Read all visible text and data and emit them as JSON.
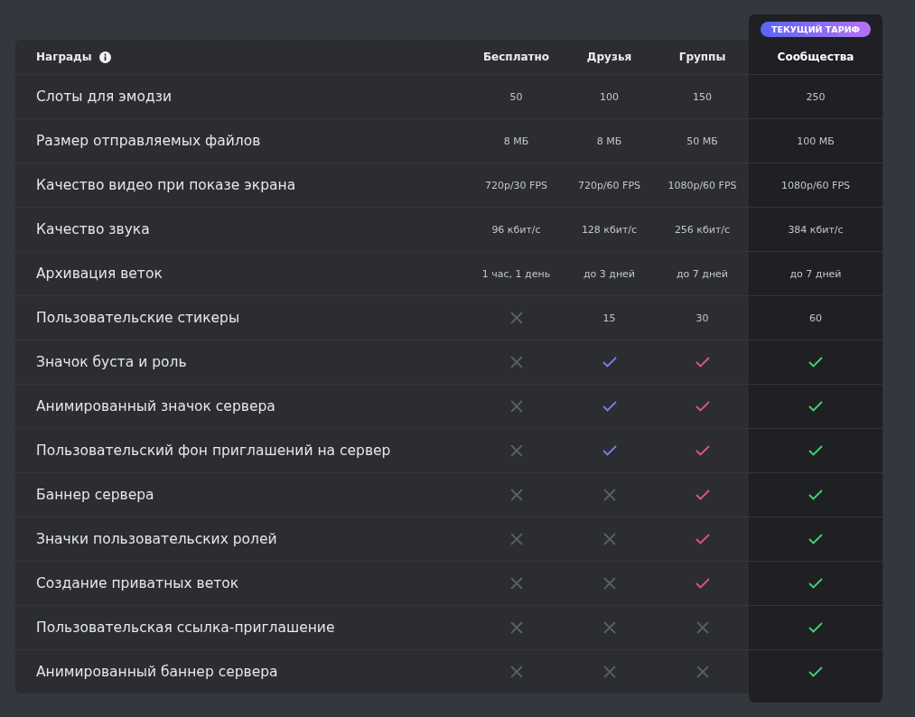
{
  "header": {
    "label": "Награды"
  },
  "current_badge": "ТЕКУЩИЙ ТАРИФ",
  "columns": [
    {
      "label": "Бесплатно",
      "selected": false
    },
    {
      "label": "Друзья",
      "color": "#7b7fe8",
      "selected": false
    },
    {
      "label": "Группы",
      "color": "#e0538f",
      "selected": false
    },
    {
      "label": "Сообщества",
      "color": "#43d17a",
      "selected": true
    }
  ],
  "rows": [
    {
      "label": "Слоты для эмодзи",
      "cells": [
        {
          "kind": "text",
          "text": "50"
        },
        {
          "kind": "text",
          "text": "100"
        },
        {
          "kind": "text",
          "text": "150"
        },
        {
          "kind": "text",
          "text": "250"
        }
      ]
    },
    {
      "label": "Размер отправляемых файлов",
      "cells": [
        {
          "kind": "text",
          "text": "8 МБ"
        },
        {
          "kind": "text",
          "text": "8 МБ"
        },
        {
          "kind": "text",
          "text": "50 МБ"
        },
        {
          "kind": "text",
          "text": "100 МБ"
        }
      ]
    },
    {
      "label": "Качество видео при показе экрана",
      "cells": [
        {
          "kind": "text",
          "text": "720p/30 FPS"
        },
        {
          "kind": "text",
          "text": "720p/60 FPS"
        },
        {
          "kind": "text",
          "text": "1080p/60 FPS"
        },
        {
          "kind": "text",
          "text": "1080p/60 FPS"
        }
      ]
    },
    {
      "label": "Качество звука",
      "cells": [
        {
          "kind": "text",
          "text": "96 кбит/с"
        },
        {
          "kind": "text",
          "text": "128 кбит/с"
        },
        {
          "kind": "text",
          "text": "256 кбит/с"
        },
        {
          "kind": "text",
          "text": "384 кбит/с"
        }
      ]
    },
    {
      "label": "Архивация веток",
      "cells": [
        {
          "kind": "text",
          "text": "1 час, 1 день"
        },
        {
          "kind": "text",
          "text": "до 3 дней"
        },
        {
          "kind": "text",
          "text": "до 7 дней"
        },
        {
          "kind": "text",
          "text": "до 7 дней"
        }
      ]
    },
    {
      "label": "Пользовательские стикеры",
      "cells": [
        {
          "kind": "cross"
        },
        {
          "kind": "text",
          "text": "15"
        },
        {
          "kind": "text",
          "text": "30"
        },
        {
          "kind": "text",
          "text": "60"
        }
      ]
    },
    {
      "label": "Значок буста и роль",
      "cells": [
        {
          "kind": "cross"
        },
        {
          "kind": "check"
        },
        {
          "kind": "check"
        },
        {
          "kind": "check"
        }
      ]
    },
    {
      "label": "Анимированный значок сервера",
      "cells": [
        {
          "kind": "cross"
        },
        {
          "kind": "check"
        },
        {
          "kind": "check"
        },
        {
          "kind": "check"
        }
      ]
    },
    {
      "label": "Пользовательский фон приглашений на сервер",
      "cells": [
        {
          "kind": "cross"
        },
        {
          "kind": "check"
        },
        {
          "kind": "check"
        },
        {
          "kind": "check"
        }
      ]
    },
    {
      "label": "Баннер сервера",
      "cells": [
        {
          "kind": "cross"
        },
        {
          "kind": "cross"
        },
        {
          "kind": "check"
        },
        {
          "kind": "check"
        }
      ]
    },
    {
      "label": "Значки пользовательских ролей",
      "cells": [
        {
          "kind": "cross"
        },
        {
          "kind": "cross"
        },
        {
          "kind": "check"
        },
        {
          "kind": "check"
        }
      ]
    },
    {
      "label": "Создание приватных веток",
      "cells": [
        {
          "kind": "cross"
        },
        {
          "kind": "cross"
        },
        {
          "kind": "check"
        },
        {
          "kind": "check"
        }
      ]
    },
    {
      "label": "Пользовательская ссылка-приглашение",
      "cells": [
        {
          "kind": "cross"
        },
        {
          "kind": "cross"
        },
        {
          "kind": "cross"
        },
        {
          "kind": "check"
        }
      ]
    },
    {
      "label": "Анимированный баннер сервера",
      "cells": [
        {
          "kind": "cross"
        },
        {
          "kind": "cross"
        },
        {
          "kind": "cross"
        },
        {
          "kind": "check"
        }
      ]
    }
  ]
}
